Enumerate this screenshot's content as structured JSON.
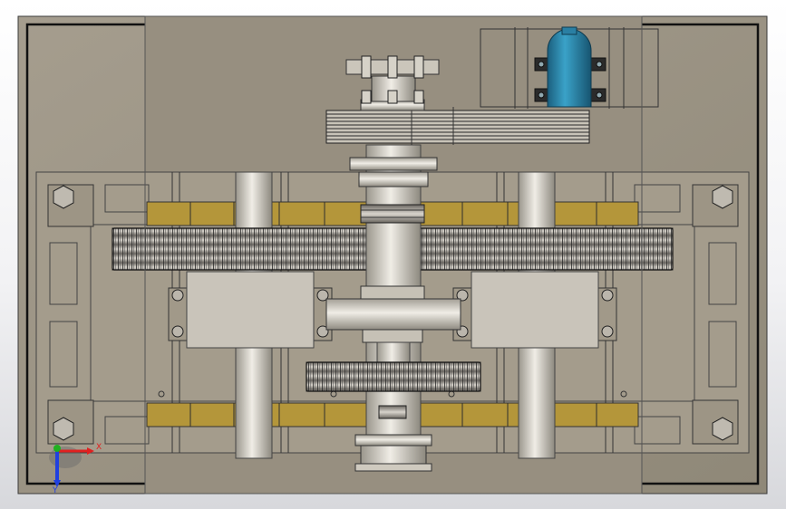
{
  "viewport": {
    "view": "top-view",
    "display_mode": "shaded-with-edges",
    "transparent_housing": true
  },
  "model": {
    "components": [
      "housing-plate",
      "motor",
      "belt-pulley",
      "input-shaft",
      "left-spur-gear",
      "right-spur-gear",
      "pinion-gear",
      "bearing-blocks",
      "output-shafts",
      "mounting-bolts"
    ]
  },
  "triad": {
    "x_label": "X",
    "y_label": "Y",
    "x_color": "#e02020",
    "y_color": "#20b020",
    "z_color": "#2040e0"
  },
  "colors": {
    "housing": "#9c9484",
    "metal": "#d6d2c8",
    "bronze_bushing": "#b89a3a",
    "motor": "#2a7fa3",
    "edge": "#2a2a2a"
  }
}
